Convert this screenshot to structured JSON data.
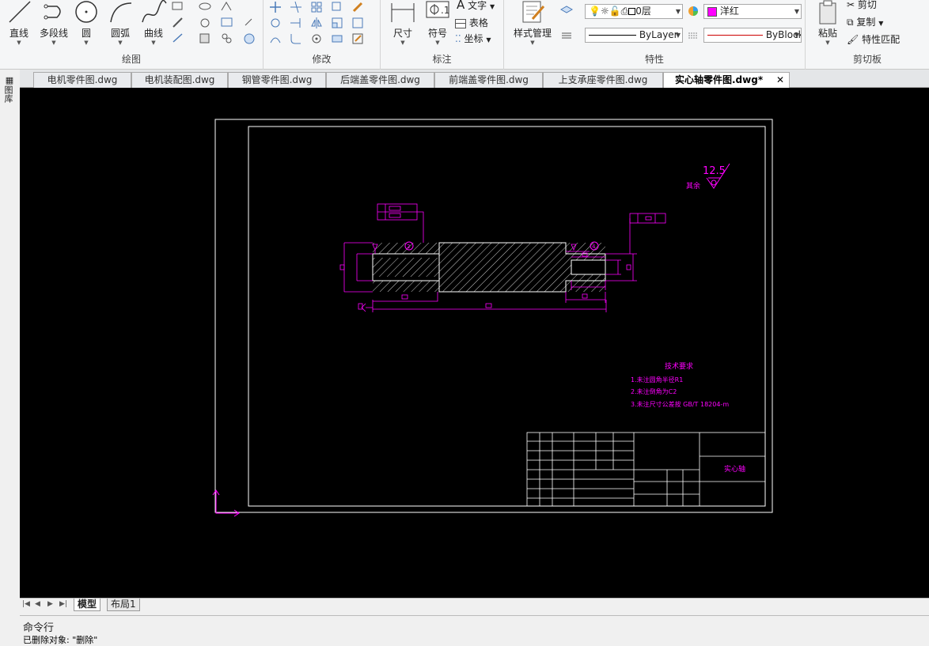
{
  "ribbon": {
    "draw": {
      "label": "绘图",
      "line": "直线",
      "polyline": "多段线",
      "circle": "圆",
      "arc": "圆弧",
      "curve": "曲线"
    },
    "modify": {
      "label": "修改"
    },
    "annotate": {
      "label": "标注",
      "dimension": "尺寸",
      "symbol": "符号",
      "text": "文字",
      "table": "表格",
      "coords": "坐标"
    },
    "props": {
      "label": "特性",
      "style_mgr": "样式管理",
      "layer": "0层",
      "color": "洋红",
      "color_hex": "#ff00ff",
      "linetype": "ByLayer",
      "lineweight": "ByBlock"
    },
    "clipboard": {
      "label": "剪切板",
      "paste": "粘贴",
      "cut": "剪切",
      "copy": "复制",
      "match": "特性匹配"
    }
  },
  "file_tabs": [
    "电机零件图.dwg",
    "电机装配图.dwg",
    "钢管零件图.dwg",
    "后端盖零件图.dwg",
    "前端盖零件图.dwg",
    "上支承座零件图.dwg",
    "实心轴零件图.dwg*"
  ],
  "sidebar_label": "图库",
  "drawing": {
    "roughness": "12.5",
    "rest_label": "其余",
    "notes_title": "技术要求",
    "notes": [
      "1.未注圆角半径R1",
      "2.未注倒角为C2",
      "3.未注尺寸公差按 GB/T 18204-m"
    ],
    "part_name": "实心轴",
    "balloons": [
      "2",
      "4"
    ]
  },
  "layout_tabs": [
    "模型",
    "布局1"
  ],
  "command": {
    "title": "命令行",
    "history": "已删除对象: \"删除\""
  }
}
